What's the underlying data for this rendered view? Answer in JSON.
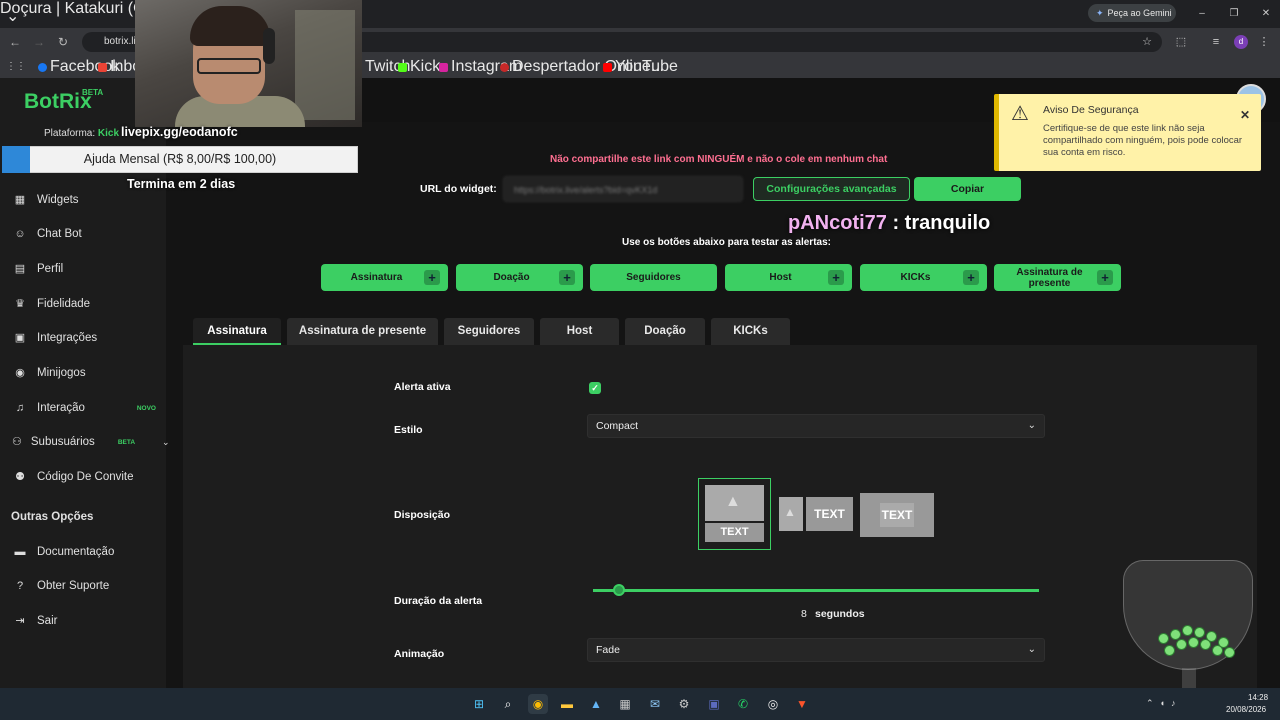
{
  "browser": {
    "tab_title": "Doçura | Katakuri (One P",
    "gemini_label": "Peça ao Gemini",
    "url": "botrix.li",
    "bookmarks": [
      "Facebook",
      "Inbox",
      "Twitch",
      "Kick",
      "Instagram",
      "Despertador Online...",
      "YouTube"
    ]
  },
  "overlay": {
    "pix_link": "livepix.gg/eodanofc",
    "goal_text": "Ajuda Mensal (R$ 8,00/R$ 100,00)",
    "goal_progress_fraction": 0.08,
    "goal_deadline": "Termina em 2 dias",
    "chat_user": "pANcoti77",
    "chat_message": " : tranquilo"
  },
  "sidebar": {
    "logo": "BotRix",
    "logo_badge": "BETA",
    "platform_label": "Plataforma:",
    "platform_value": "Kick",
    "items": [
      {
        "label": "Widgets",
        "icon": "grid-icon"
      },
      {
        "label": "Chat Bot",
        "icon": "robot-icon"
      },
      {
        "label": "Perfil",
        "icon": "id-card-icon"
      },
      {
        "label": "Fidelidade",
        "icon": "trophy-icon"
      },
      {
        "label": "Integrações",
        "icon": "plug-icon"
      },
      {
        "label": "Minijogos",
        "icon": "gamepad-icon"
      },
      {
        "label": "Interação",
        "icon": "music-icon",
        "badge": "NOVO"
      },
      {
        "label": "Subusuários",
        "icon": "users-icon",
        "badge": "BETA"
      },
      {
        "label": "Código De Convite",
        "icon": "user-plus-icon"
      }
    ],
    "other_section": "Outras Opções",
    "other_items": [
      {
        "label": "Documentação",
        "icon": "doc-icon"
      },
      {
        "label": "Obter Suporte",
        "icon": "help-icon"
      },
      {
        "label": "Sair",
        "icon": "logout-icon"
      }
    ]
  },
  "toast": {
    "title": "Aviso De Segurança",
    "message": "Certifique-se de que este link não seja compartilhado com ninguém, pois pode colocar sua conta em risco."
  },
  "widget": {
    "warning": "Não compartilhe este link com NINGUÉM e não o cole em nenhum chat",
    "url_label": "URL do widget:",
    "url_value": "https://botrix.live/alerts?bid=qvKX1d",
    "advanced_button": "Configurações avançadas",
    "copy_button": "Copiar",
    "test_label": "Use os botões abaixo para testar as alertas:",
    "test_buttons": [
      "Assinatura",
      "Doação",
      "Seguidores",
      "Host",
      "KICKs",
      "Assinatura de presente"
    ]
  },
  "tabs": [
    "Assinatura",
    "Assinatura de presente",
    "Seguidores",
    "Host",
    "Doação",
    "KICKs"
  ],
  "active_tab": "Assinatura",
  "form": {
    "alert_active_label": "Alerta ativa",
    "alert_active": true,
    "style_label": "Estilo",
    "style_value": "Compact",
    "layout_label": "Disposição",
    "layout_text": "TEXT",
    "duration_label": "Duração da alerta",
    "duration_value": "8",
    "duration_unit": "segundos",
    "animation_label": "Animação",
    "animation_value": "Fade"
  },
  "taskbar": {
    "time": "14:28",
    "date": "20/08/2026"
  },
  "colors": {
    "accent": "#3ccf63",
    "warning_text": "#ff6f91",
    "toast_bg": "#fff2a8"
  }
}
